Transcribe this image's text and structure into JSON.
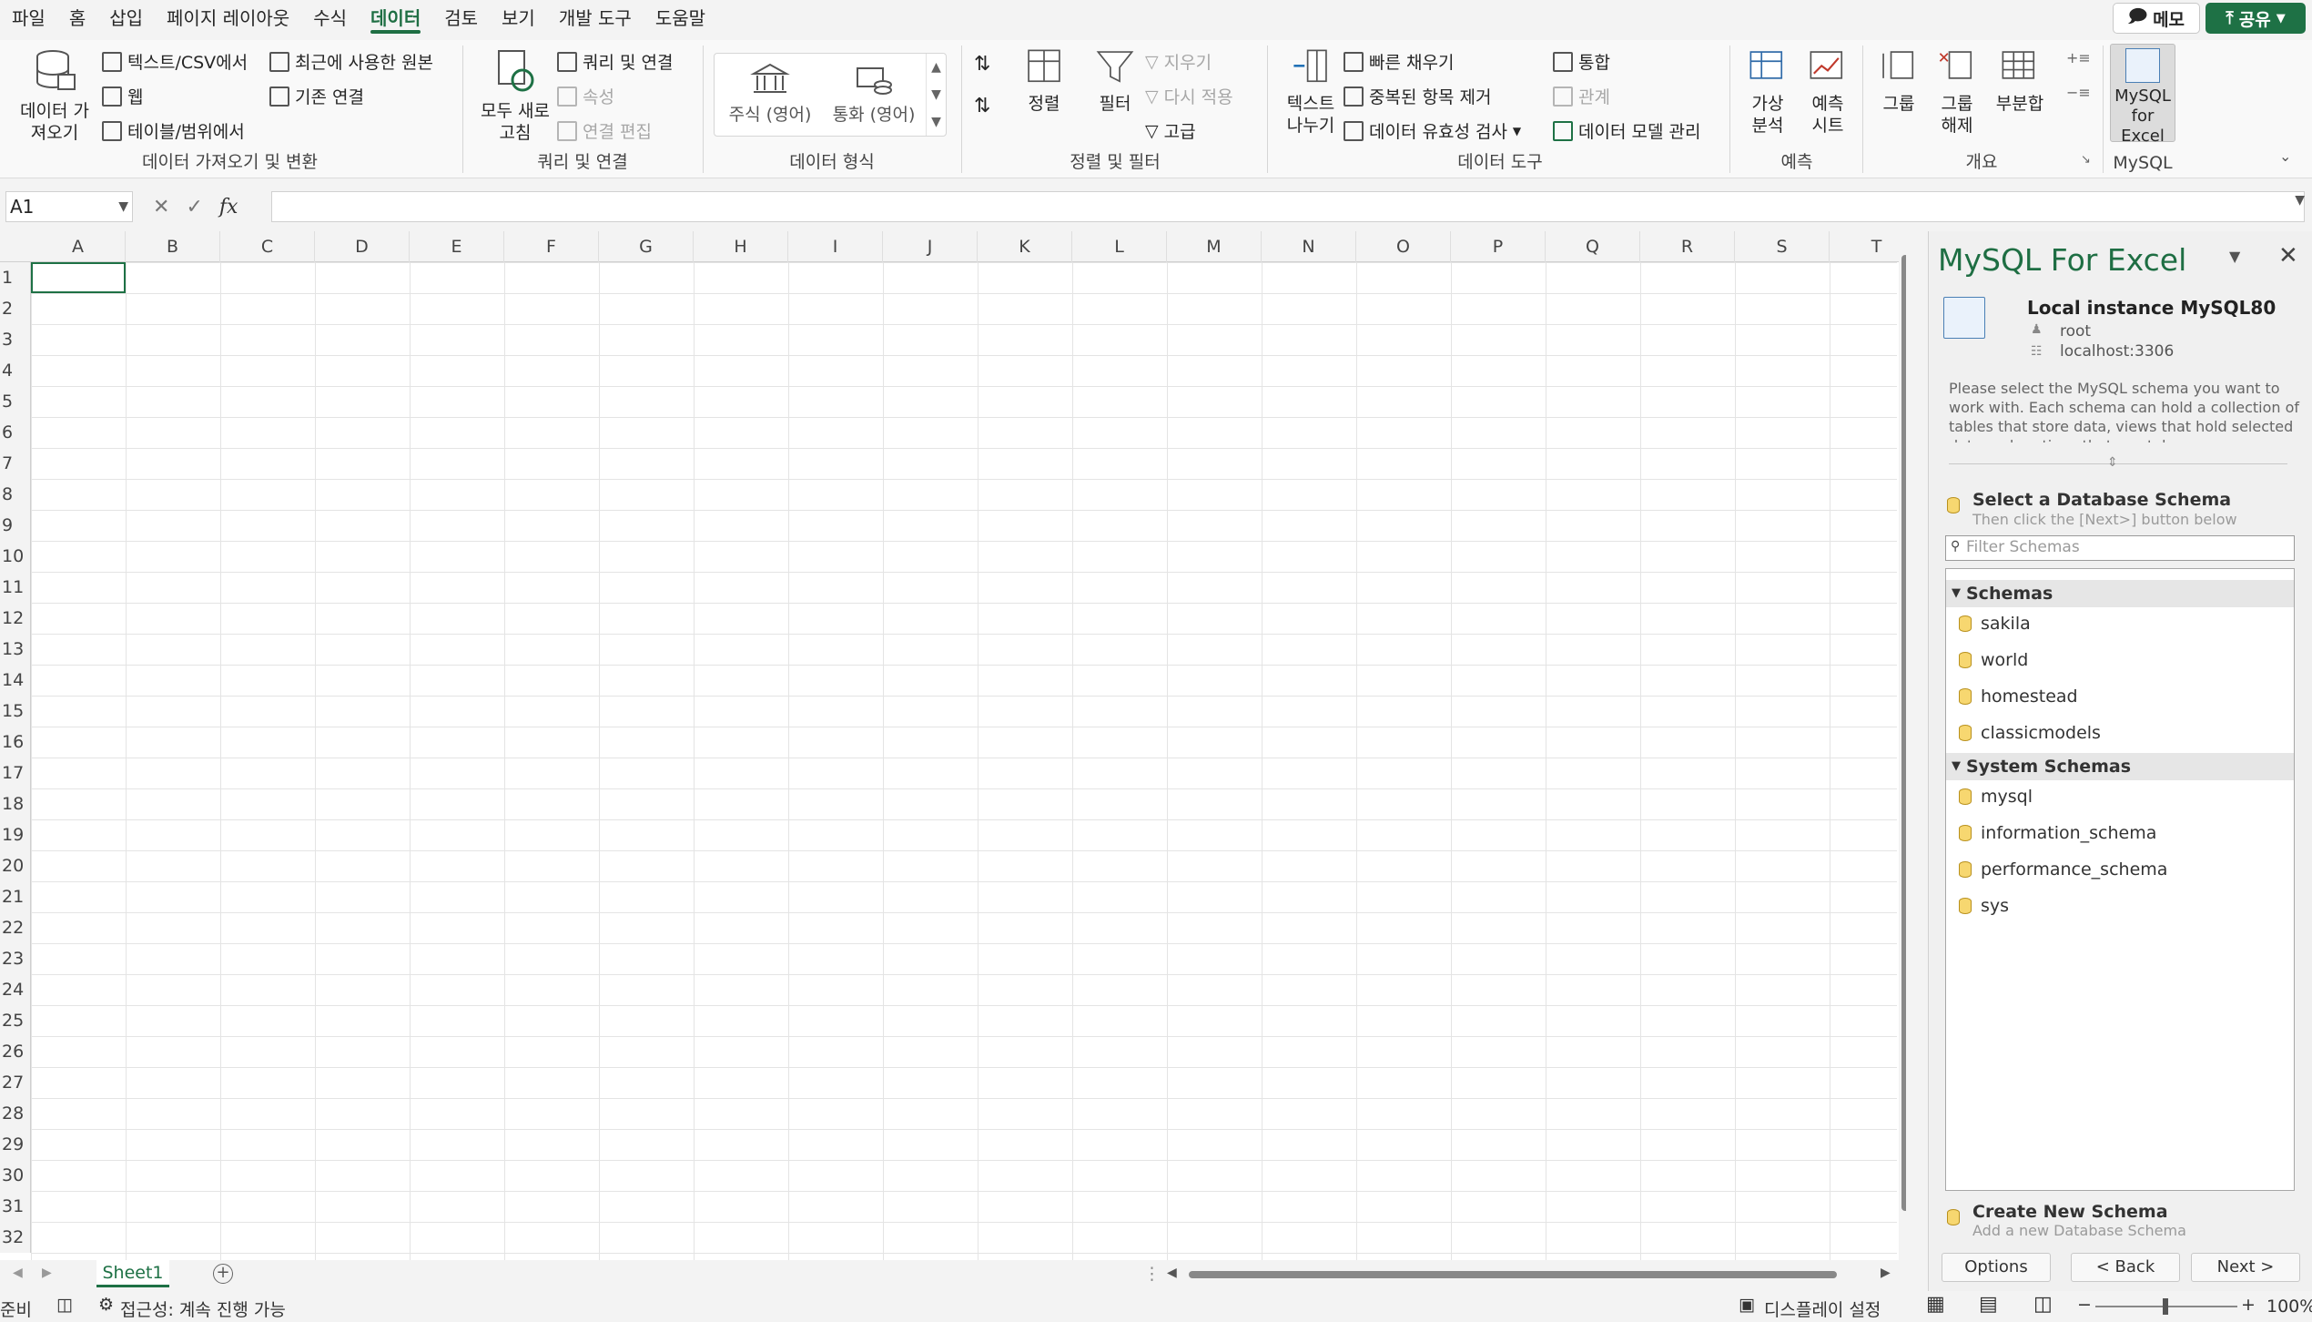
{
  "menu": {
    "tabs": [
      "파일",
      "홈",
      "삽입",
      "페이지 레이아웃",
      "수식",
      "데이터",
      "검토",
      "보기",
      "개발 도구",
      "도움말"
    ],
    "active_tab": "데이터",
    "memo_label": "메모",
    "share_label": "공유"
  },
  "ribbon": {
    "get_data": {
      "big_button": "데이터 가져오기",
      "from_text": "텍스트/CSV에서",
      "web": "웹",
      "from_table": "테이블/범위에서",
      "recent_sources": "최근에 사용한 원본",
      "existing_connections": "기존 연결",
      "group_label": "데이터 가져오기 및 변환"
    },
    "queries": {
      "refresh_all": "모두 새로 고침",
      "queries_connections": "쿼리 및 연결",
      "properties": "속성",
      "edit_links": "연결 편집",
      "group_label": "쿼리 및 연결"
    },
    "data_types": {
      "stocks": "주식 (영어)",
      "currencies": "통화 (영어)",
      "group_label": "데이터 형식"
    },
    "sort_filter": {
      "sort": "정렬",
      "filter": "필터",
      "clear": "지우기",
      "reapply": "다시 적용",
      "advanced": "고급",
      "group_label": "정렬 및 필터"
    },
    "data_tools": {
      "text_to_columns": "텍스트 나누기",
      "flash_fill": "빠른 채우기",
      "remove_duplicates": "중복된 항목 제거",
      "data_validation": "데이터 유효성 검사",
      "consolidate": "통합",
      "relationships": "관계",
      "data_model": "데이터 모델 관리",
      "group_label": "데이터 도구"
    },
    "forecast": {
      "what_if": "가상 분석",
      "forecast_sheet": "예측 시트",
      "group_label": "예측"
    },
    "outline": {
      "group": "그룹",
      "ungroup": "그룹 해제",
      "subtotal": "부분합",
      "group_label": "개요"
    },
    "mysql": {
      "button": "MySQL for Excel",
      "group_label": "MySQL"
    }
  },
  "formula_bar": {
    "name_box": "A1",
    "fx": "fx",
    "value": ""
  },
  "grid": {
    "columns": [
      "A",
      "B",
      "C",
      "D",
      "E",
      "F",
      "G",
      "H",
      "I",
      "J",
      "K",
      "L",
      "M",
      "N",
      "O",
      "P",
      "Q",
      "R",
      "S",
      "T"
    ],
    "rows": [
      "1",
      "2",
      "3",
      "4",
      "5",
      "6",
      "7",
      "8",
      "9",
      "10",
      "11",
      "12",
      "13",
      "14",
      "15",
      "16",
      "17",
      "18",
      "19",
      "20",
      "21",
      "22",
      "23",
      "24",
      "25",
      "26",
      "27",
      "28",
      "29",
      "30",
      "31",
      "32"
    ]
  },
  "sheet_tabs": {
    "active": "Sheet1"
  },
  "status_bar": {
    "ready": "준비",
    "accessibility": "접근성: 계속 진행 가능",
    "display_settings": "디스플레이 설정",
    "zoom": "100%"
  },
  "panel": {
    "title": "MySQL For Excel",
    "connection": {
      "name": "Local instance MySQL80",
      "user": "root",
      "host": "localhost:3306"
    },
    "description": "Please select the MySQL schema you want to work with. Each schema can hold a collection of tables that store data, views that hold selected data and routines that can take ...",
    "select_title": "Select a Database Schema",
    "select_subtitle": "Then click the [Next>] button below",
    "filter_placeholder": "Filter Schemas",
    "schemas_header": "Schemas",
    "schemas": [
      "sakila",
      "world",
      "homestead",
      "classicmodels"
    ],
    "system_header": "System Schemas",
    "system_schemas": [
      "mysql",
      "information_schema",
      "performance_schema",
      "sys"
    ],
    "create_title": "Create New Schema",
    "create_subtitle": "Add a new Database Schema",
    "options_button": "Options",
    "back_button": "< Back",
    "next_button": "Next >"
  },
  "colors": {
    "accent": "#1e7145",
    "title_green": "#1e6e43"
  }
}
